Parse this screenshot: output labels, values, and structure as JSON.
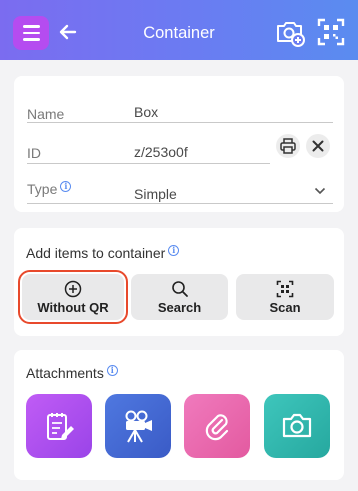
{
  "header": {
    "title": "Container",
    "menu_icon": "hamburger-menu-icon",
    "back_icon": "back-arrow-icon",
    "add_photo_icon": "camera-add-icon",
    "scan_icon": "qr-scan-icon",
    "gradient_start": "#7b6cf0",
    "gradient_end": "#5a8cf0",
    "menu_color": "#b54cf0"
  },
  "details": {
    "name_label": "Name",
    "name_value": "Box",
    "id_label": "ID",
    "id_value": "z/253o0f",
    "type_label": "Type",
    "type_value": "Simple"
  },
  "add_items": {
    "title": "Add items to container",
    "buttons": [
      {
        "label": "Without QR",
        "icon": "plus-circle-icon"
      },
      {
        "label": "Search",
        "icon": "search-icon"
      },
      {
        "label": "Scan",
        "icon": "qr-scan-icon"
      }
    ]
  },
  "attachments": {
    "title": "Attachments",
    "tiles": [
      {
        "icon": "note-edit-icon",
        "color": "#a855f0"
      },
      {
        "icon": "video-camera-icon",
        "color": "#4a6fd8"
      },
      {
        "icon": "paperclip-icon",
        "color": "#ec6fb0"
      },
      {
        "icon": "camera-icon",
        "color": "#2fb8b0"
      }
    ]
  }
}
